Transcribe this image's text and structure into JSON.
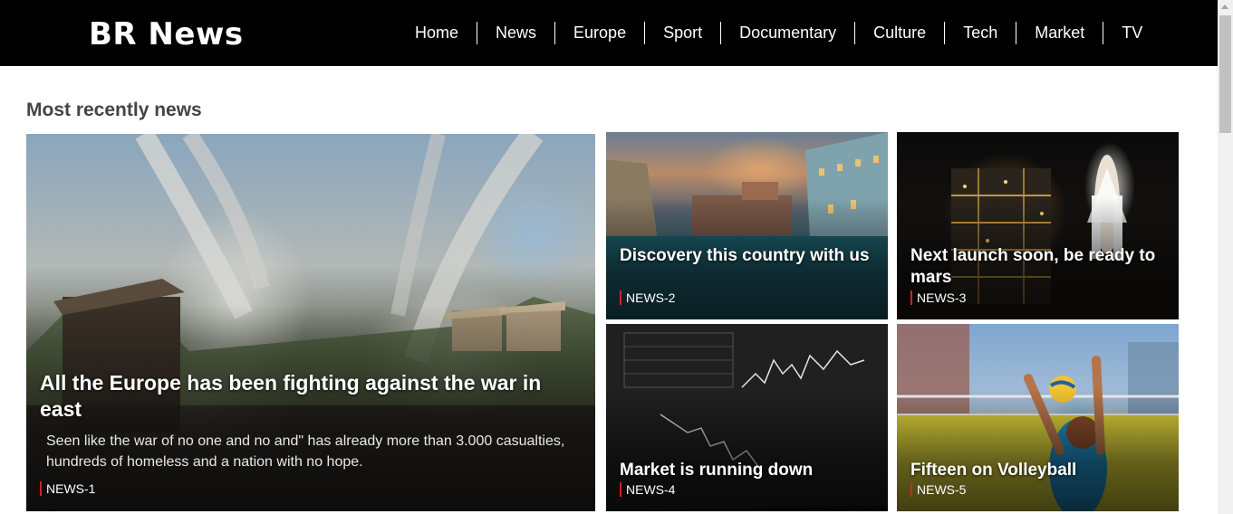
{
  "header": {
    "logo": "BR News",
    "nav": [
      "Home",
      "News",
      "Europe",
      "Sport",
      "Documentary",
      "Culture",
      "Tech",
      "Market",
      "TV"
    ]
  },
  "section": {
    "title": "Most recently news"
  },
  "cards": [
    {
      "title": "All the Europe has been fighting against the war in east",
      "description": "Seen like the war of no one and no and\" has already more than 3.000 casualties, hundreds of homeless and a nation with no hope.",
      "tag": "NEWS-1",
      "image": "war-explosion-image"
    },
    {
      "title": "Discovery this country with us",
      "tag": "NEWS-2",
      "image": "venice-canal-image"
    },
    {
      "title": "Next launch soon, be ready to mars",
      "tag": "NEWS-3",
      "image": "space-shuttle-launch-image"
    },
    {
      "title": "Market is running down",
      "tag": "NEWS-4",
      "image": "stock-chart-screen-image"
    },
    {
      "title": "Fifteen on Volleyball",
      "tag": "NEWS-5",
      "image": "volleyball-player-image"
    }
  ],
  "colors": {
    "header_bg": "#000000",
    "tag_accent": "#d61f26",
    "section_title": "#444444"
  }
}
